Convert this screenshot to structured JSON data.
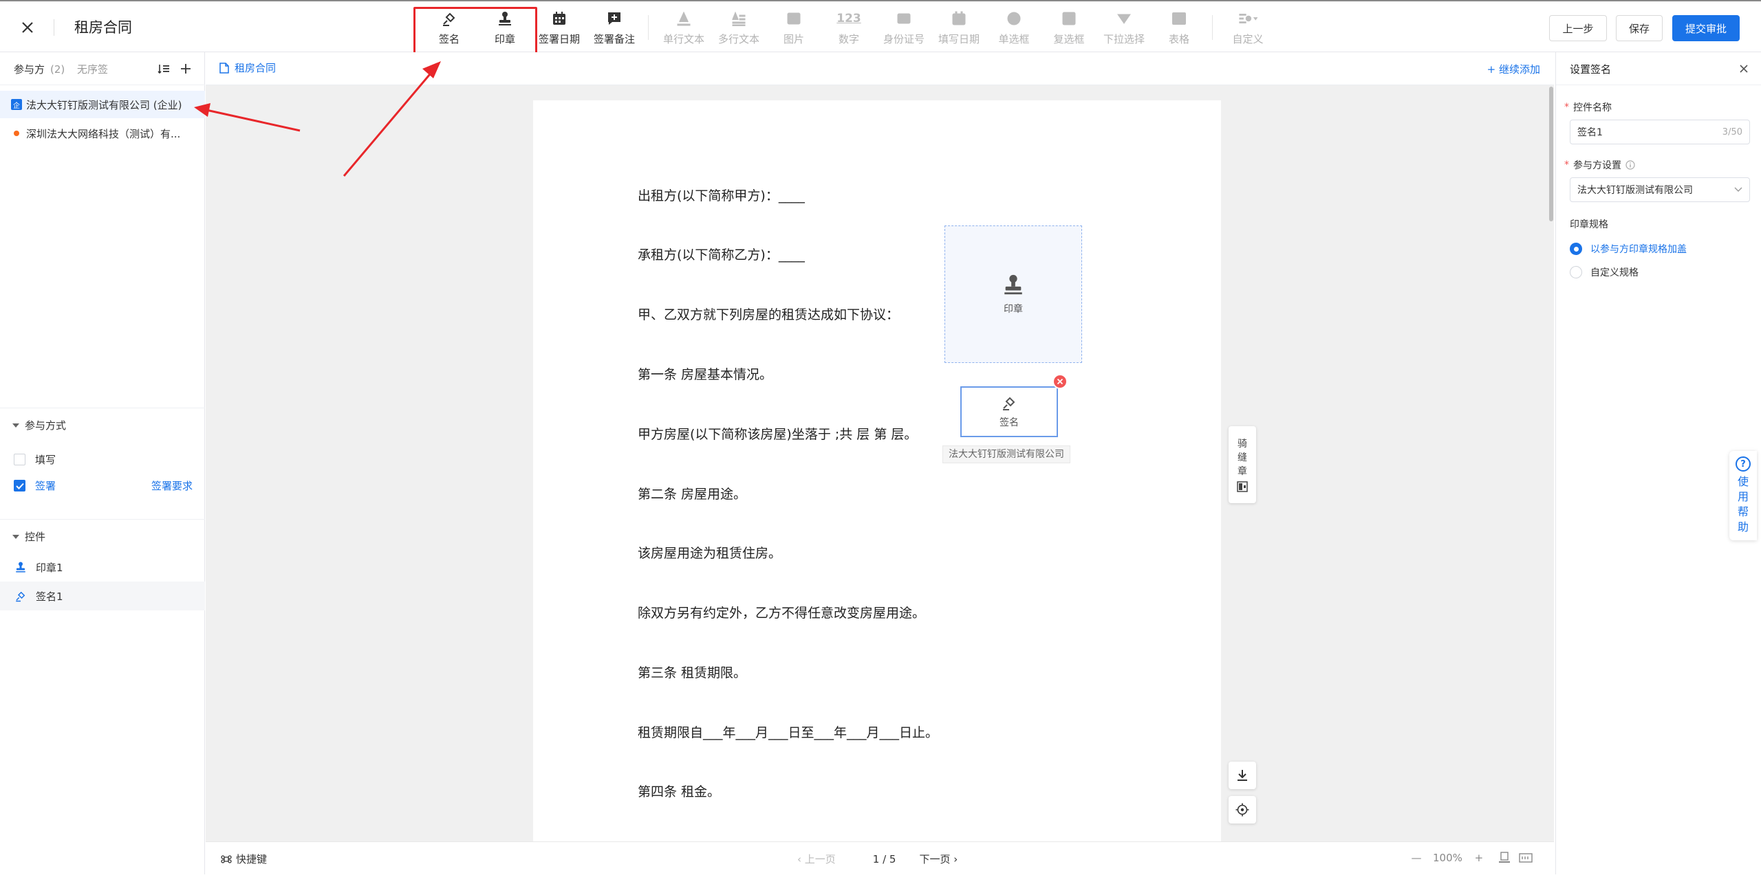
{
  "header": {
    "title": "租房合同",
    "prev_label": "上一步",
    "save_label": "保存",
    "submit_label": "提交审批"
  },
  "toolbar": {
    "tools": [
      {
        "label": "签名",
        "icon": "signature-icon",
        "enabled": true
      },
      {
        "label": "印章",
        "icon": "stamp-icon",
        "enabled": true
      },
      {
        "label": "签署日期",
        "icon": "calendar-icon",
        "enabled": true
      },
      {
        "label": "签署备注",
        "icon": "note-add-icon",
        "enabled": true
      },
      {
        "label": "单行文本",
        "icon": "text-a-icon",
        "enabled": false
      },
      {
        "label": "多行文本",
        "icon": "text-lines-icon",
        "enabled": false
      },
      {
        "label": "图片",
        "icon": "image-icon",
        "enabled": false
      },
      {
        "label": "数字",
        "icon": "number-123-icon",
        "enabled": false
      },
      {
        "label": "身份证号",
        "icon": "id-card-icon",
        "enabled": false
      },
      {
        "label": "填写日期",
        "icon": "calendar-icon",
        "enabled": false
      },
      {
        "label": "单选框",
        "icon": "radio-icon",
        "enabled": false
      },
      {
        "label": "复选框",
        "icon": "checkbox-icon",
        "enabled": false
      },
      {
        "label": "下拉选择",
        "icon": "dropdown-icon",
        "enabled": false
      },
      {
        "label": "表格",
        "icon": "table-icon",
        "enabled": false
      },
      {
        "label": "自定义",
        "icon": "custom-icon",
        "enabled": false
      }
    ],
    "icon_123": "123"
  },
  "sidebar": {
    "title": "参与方",
    "count": "(2)",
    "order_label": "无序签",
    "parties": [
      {
        "name": "法大大钉钉版测试有限公司 (企业)",
        "badge": "企"
      },
      {
        "name": "深圳法大大网络科技（测试）有..."
      }
    ],
    "mode_section": {
      "title": "参与方式",
      "options": [
        {
          "label": "填写",
          "checked": false
        },
        {
          "label": "签署",
          "checked": true
        }
      ],
      "requirement_link": "签署要求"
    },
    "controls_section": {
      "title": "控件",
      "items": [
        {
          "label": "印章1",
          "icon": "stamp-icon"
        },
        {
          "label": "签名1",
          "icon": "signature-icon"
        }
      ]
    }
  },
  "center": {
    "file_tab": "租房合同",
    "continue_add": "+ 继续添加",
    "paragraphs": [
      "出租方(以下简称甲方)：____",
      "承租方(以下简称乙方)：____",
      "甲、乙双方就下列房屋的租赁达成如下协议：",
      "第一条  房屋基本情况。",
      "甲方房屋(以下简称该房屋)坐落于 ;共  层  第  层。",
      "第二条  房屋用途。",
      "该房屋用途为租赁住房。",
      "除双方另有约定外，乙方不得任意改变房屋用途。",
      "第三条  租赁期限。",
      "租赁期限自___年___月___日至___年___月___日止。",
      "第四条  租金。"
    ],
    "seal_label": "印章",
    "sign_label": "签名",
    "owner_tag": "法大大钉钉版测试有限公司",
    "riding_seal": [
      "骑",
      "缝",
      "章"
    ]
  },
  "footer": {
    "shortcut_label": "快捷键",
    "prev_page": "上一页",
    "page_indicator": "1 / 5",
    "next_page": "下一页",
    "zoom_minus": "—",
    "zoom_value": "100%",
    "zoom_plus": "+"
  },
  "right_panel": {
    "title": "设置签名",
    "name_label": "控件名称",
    "name_value": "签名1",
    "name_counter": "3/50",
    "party_label": "参与方设置",
    "party_value": "法大大钉钉版测试有限公司",
    "seal_spec_label": "印章规格",
    "spec_options": [
      {
        "label": "以参与方印章规格加盖",
        "selected": true
      },
      {
        "label": "自定义规格",
        "selected": false
      }
    ]
  },
  "help": {
    "q": "?",
    "chars": [
      "使",
      "用",
      "帮",
      "助"
    ]
  },
  "colors": {
    "primary": "#1a73e8",
    "highlight": "#e8262a",
    "danger": "#f25555",
    "party_dot": "#fa6b1c"
  }
}
